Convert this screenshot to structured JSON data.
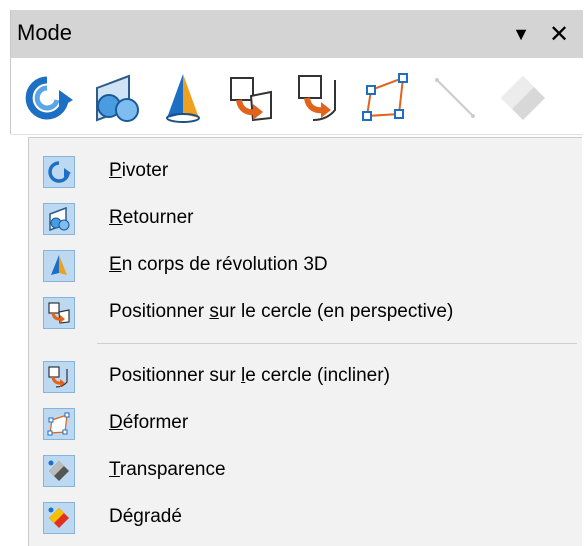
{
  "panel": {
    "title": "Mode",
    "dropdown_glyph": "▼",
    "close_glyph": "✕"
  },
  "toolbar_icons": [
    {
      "name": "rotate-icon",
      "enabled": true
    },
    {
      "name": "flip-icon",
      "enabled": true
    },
    {
      "name": "3d-rotation-object-icon",
      "enabled": true
    },
    {
      "name": "set-in-circle-perspective-icon",
      "enabled": true
    },
    {
      "name": "set-in-circle-slant-icon",
      "enabled": true
    },
    {
      "name": "distort-icon",
      "enabled": true
    },
    {
      "name": "interactive-transparency-icon",
      "enabled": false
    },
    {
      "name": "interactive-gradient-icon",
      "enabled": false
    }
  ],
  "menu": {
    "items": [
      {
        "pre": "",
        "key": "P",
        "post": "ivoter",
        "icon": "rotate-icon"
      },
      {
        "pre": "",
        "key": "R",
        "post": "etourner",
        "icon": "flip-icon"
      },
      {
        "pre": "",
        "key": "E",
        "post": "n corps de révolution 3D",
        "icon": "3d-rotation-object-icon"
      },
      {
        "pre": "Positionner ",
        "key": "s",
        "post": "ur le cercle (en perspective)",
        "icon": "set-in-circle-perspective-icon"
      },
      {
        "pre": "Positionner sur ",
        "key": "l",
        "post": "e cercle (incliner)",
        "icon": "set-in-circle-slant-icon"
      },
      {
        "pre": "",
        "key": "D",
        "post": "éformer",
        "icon": "distort-icon"
      },
      {
        "pre": "",
        "key": "T",
        "post": "ransparence",
        "icon": "transparency-icon"
      },
      {
        "pre": "Dé",
        "key": "g",
        "post": "radé",
        "icon": "gradient-icon"
      }
    ]
  },
  "colors": {
    "titlebar": "#d4d4d4",
    "menu_bg": "#f2f2f2",
    "icon_highlight": "#bcd9f1",
    "accent_blue": "#2b7fd6",
    "accent_orange": "#e2641c"
  }
}
